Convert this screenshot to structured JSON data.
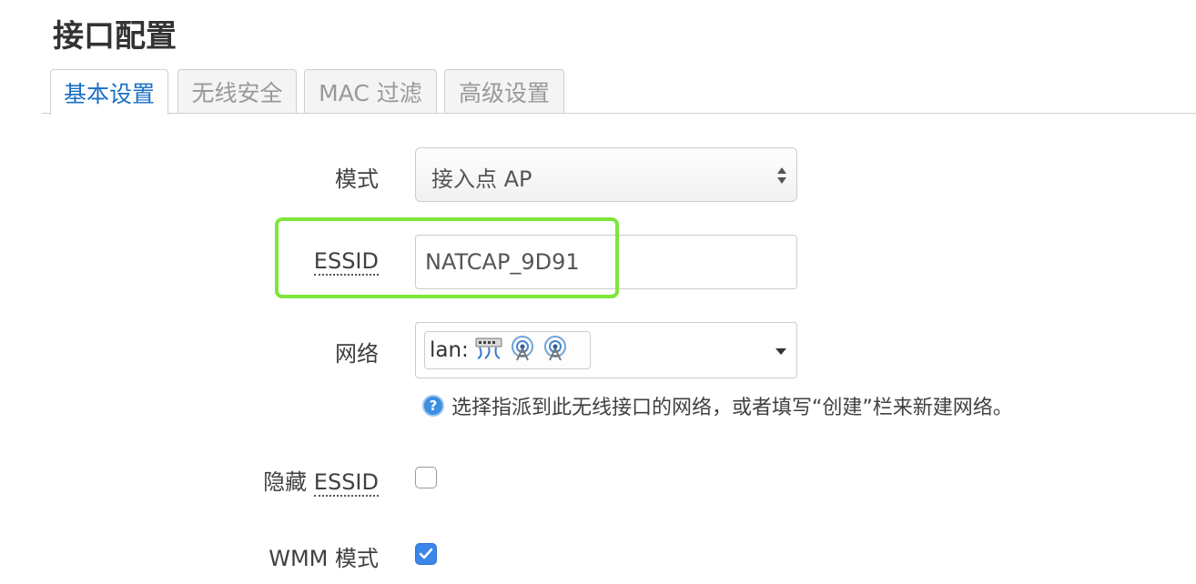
{
  "page": {
    "title": "接口配置"
  },
  "tabs": [
    {
      "label": "基本设置",
      "active": true
    },
    {
      "label": "无线安全",
      "active": false
    },
    {
      "label": "MAC 过滤",
      "active": false
    },
    {
      "label": "高级设置",
      "active": false
    }
  ],
  "form": {
    "mode": {
      "label": "模式",
      "value": "接入点 AP"
    },
    "essid": {
      "label": "ESSID",
      "value": "NATCAP_9D91"
    },
    "network": {
      "label": "网络",
      "chip_text": "lan:",
      "chip_icons": [
        "ethernet-switch-icon",
        "wifi-icon",
        "wifi-icon"
      ],
      "help_text": "选择指派到此无线接口的网络，或者填写“创建”栏来新建网络。"
    },
    "hide_essid": {
      "label_prefix": "隐藏",
      "label_term": "ESSID",
      "checked": false
    },
    "wmm_mode": {
      "label": "WMM 模式",
      "checked": true
    }
  },
  "colors": {
    "accent": "#1a6fc4",
    "highlight": "#7ee63a",
    "checkbox": "#3b86e8"
  }
}
